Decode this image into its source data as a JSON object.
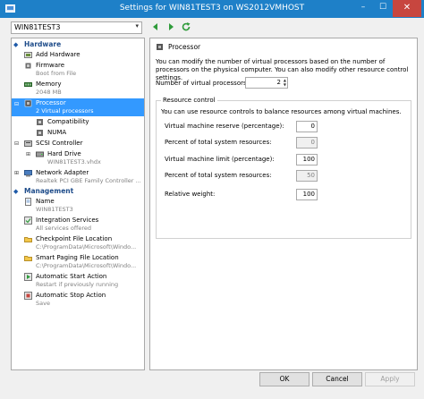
{
  "window": {
    "title": "Settings for WIN81TEST3 on WS2012VMHOST",
    "minimize": "–",
    "maximize": "☐",
    "close": "✕"
  },
  "vm_selector": {
    "value": "WIN81TEST3",
    "arrow": "▾"
  },
  "tree": {
    "hardware_header": "Hardware",
    "management_header": "Management",
    "add_hardware": "Add Hardware",
    "firmware": {
      "label": "Firmware",
      "sub": "Boot from File"
    },
    "memory": {
      "label": "Memory",
      "sub": "2048 MB"
    },
    "processor": {
      "label": "Processor",
      "sub": "2 Virtual processors"
    },
    "compatibility": "Compatibility",
    "numa": "NUMA",
    "scsi": "SCSI Controller",
    "hard_drive": {
      "label": "Hard Drive",
      "sub": "WIN81TEST3.vhdx"
    },
    "network": {
      "label": "Network Adapter",
      "sub": "Realtek PCI GBE Family Controller ..."
    },
    "name": {
      "label": "Name",
      "sub": "WIN81TEST3"
    },
    "integration": {
      "label": "Integration Services",
      "sub": "All services offered"
    },
    "checkpoint": {
      "label": "Checkpoint File Location",
      "sub": "C:\\ProgramData\\Microsoft\\Windo..."
    },
    "smart_paging": {
      "label": "Smart Paging File Location",
      "sub": "C:\\ProgramData\\Microsoft\\Windo..."
    },
    "auto_start": {
      "label": "Automatic Start Action",
      "sub": "Restart if previously running"
    },
    "auto_stop": {
      "label": "Automatic Stop Action",
      "sub": "Save"
    }
  },
  "panel": {
    "heading": "Processor",
    "description": "You can modify the number of virtual processors based on the number of processors on the physical computer. You can also modify other resource control settings.",
    "num_processors_label": "Number of virtual processors:",
    "num_processors_value": "2",
    "resource_control_title": "Resource control",
    "resource_control_desc": "You can use resource controls to balance resources among virtual machines.",
    "reserve_label": "Virtual machine reserve (percentage):",
    "reserve_value": "0",
    "reserve_total_label": "Percent of total system resources:",
    "reserve_total_value": "0",
    "limit_label": "Virtual machine limit (percentage):",
    "limit_value": "100",
    "limit_total_label": "Percent of total system resources:",
    "limit_total_value": "50",
    "weight_label": "Relative weight:",
    "weight_value": "100"
  },
  "buttons": {
    "ok": "OK",
    "cancel": "Cancel",
    "apply": "Apply"
  },
  "colors": {
    "titlebar": "#1e80c8",
    "selection": "#3399ff",
    "close": "#c7463f"
  }
}
